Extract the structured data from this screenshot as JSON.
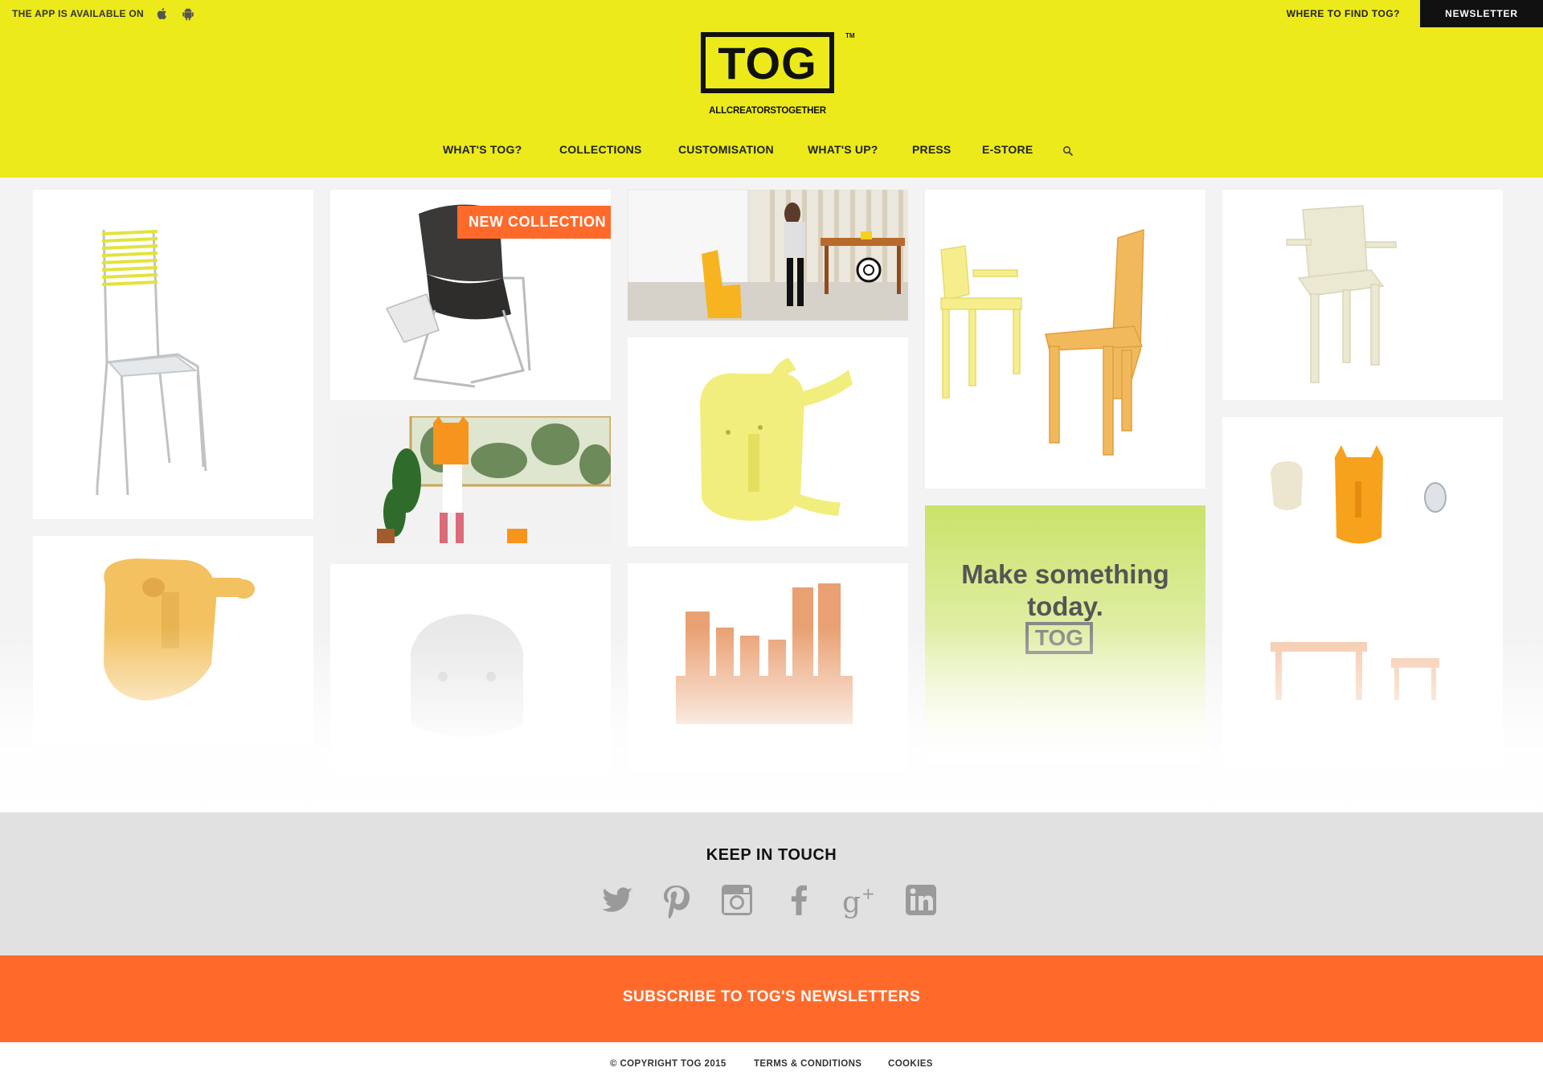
{
  "topbar": {
    "app_text": "THE APP IS AVAILABLE ON",
    "ios_icon": "apple-icon",
    "android_icon": "android-icon",
    "where_link": "WHERE TO FIND TOG?",
    "newsletter_label": "NEWSLETTER"
  },
  "logo": {
    "word": "TOG",
    "tm": "TM",
    "tagline": "ALLCREATORSTOGETHER"
  },
  "nav": {
    "items": [
      {
        "label": "WHAT'S TOG?"
      },
      {
        "label": "COLLECTIONS"
      },
      {
        "label": "CUSTOMISATION"
      },
      {
        "label": "WHAT'S UP?"
      },
      {
        "label": "PRESS"
      },
      {
        "label": "E-STORE"
      }
    ],
    "search_icon": "search-icon"
  },
  "grid": {
    "badge": "NEW COLLECTION",
    "promo": {
      "line1": "Make something",
      "line2": "today.",
      "logo": "TOG"
    }
  },
  "keep_in_touch": {
    "title": "KEEP IN TOUCH",
    "social": [
      "twitter-icon",
      "pinterest-icon",
      "instagram-icon",
      "facebook-icon",
      "google-plus-icon",
      "linkedin-icon"
    ]
  },
  "subscribe": {
    "label": "SUBSCRIBE TO TOG'S NEWSLETTERS"
  },
  "footer": {
    "copyright": "© COPYRIGHT TOG 2015",
    "terms": "TERMS & CONDITIONS",
    "cookies": "COOKIES"
  },
  "colors": {
    "header_bg": "#ecea1a",
    "accent_orange": "#ff6a2b",
    "social_grey": "#9a9a9a",
    "keep_bg": "#e1e1e1"
  }
}
